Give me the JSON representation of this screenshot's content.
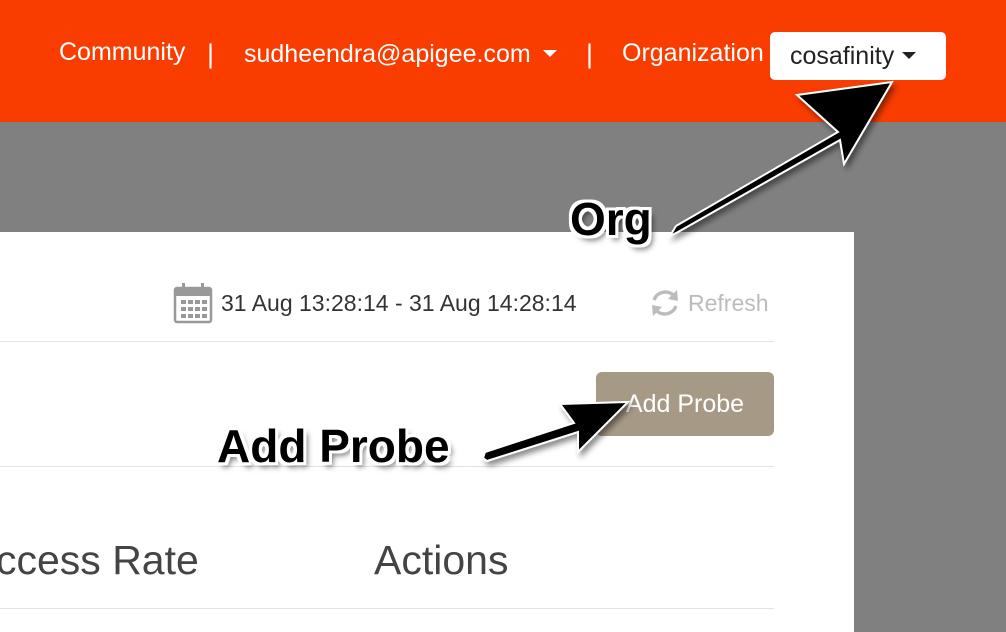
{
  "header": {
    "community_label": "Community",
    "separator": "|",
    "user_email": "sudheendra@apigee.com",
    "organization_label": "Organization",
    "organization_value": "cosafinity",
    "background_color": "#f93c00"
  },
  "toolbar": {
    "date_range": "31 Aug 13:28:14 - 31 Aug 14:28:14",
    "refresh_label": "Refresh",
    "calendar_icon": "calendar-icon",
    "refresh_icon": "refresh-icon"
  },
  "actions": {
    "add_probe_label": "Add Probe",
    "add_probe_color": "#a69a87"
  },
  "table": {
    "columns": [
      "ccess Rate",
      "Actions"
    ]
  },
  "annotations": {
    "org": "Org",
    "add_probe": "Add Probe"
  }
}
